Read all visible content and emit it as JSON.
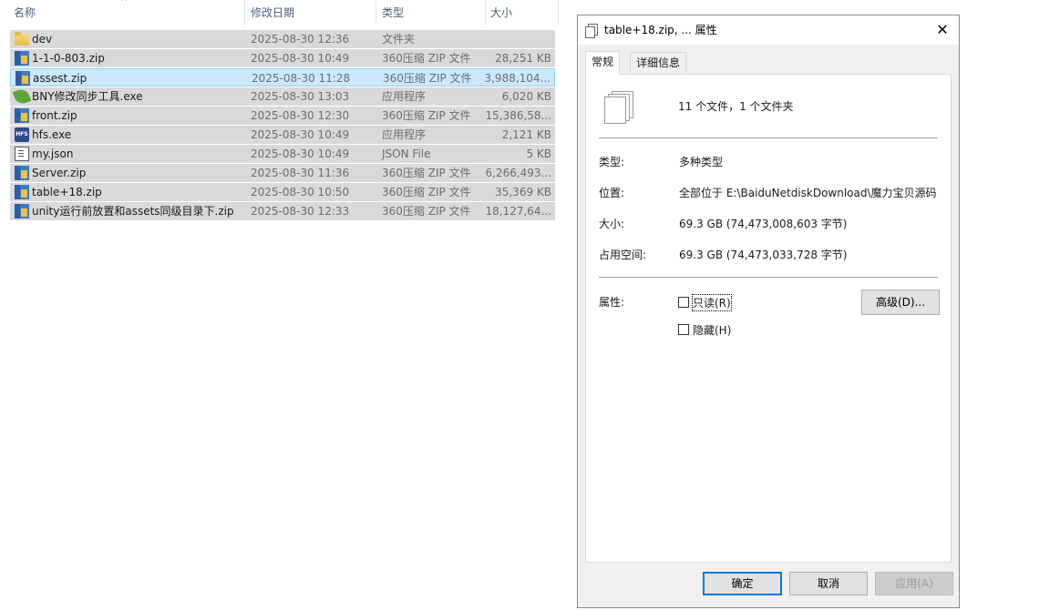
{
  "explorer": {
    "headers": {
      "name": "名称",
      "date": "修改日期",
      "type": "类型",
      "size": "大小"
    },
    "files": [
      {
        "name": "dev",
        "date": "2025-08-30 12:36",
        "type": "文件夹",
        "size": "",
        "icon": "folder-icon",
        "selected": false
      },
      {
        "name": "1-1-0-803.zip",
        "date": "2025-08-30 10:49",
        "type": "360压缩 ZIP 文件",
        "size": "28,251 KB",
        "icon": "zip-icon",
        "selected": false
      },
      {
        "name": "assest.zip",
        "date": "2025-08-30 11:28",
        "type": "360压缩 ZIP 文件",
        "size": "3,988,104...",
        "icon": "zip-icon",
        "selected": true
      },
      {
        "name": "BNY修改同步工具.exe",
        "date": "2025-08-30 13:03",
        "type": "应用程序",
        "size": "6,020 KB",
        "icon": "leaf-icon",
        "selected": false
      },
      {
        "name": "front.zip",
        "date": "2025-08-30 12:30",
        "type": "360压缩 ZIP 文件",
        "size": "15,386,58...",
        "icon": "zip-icon",
        "selected": false
      },
      {
        "name": "hfs.exe",
        "date": "2025-08-30 10:49",
        "type": "应用程序",
        "size": "2,121 KB",
        "icon": "hfs-icon",
        "selected": false
      },
      {
        "name": "my.json",
        "date": "2025-08-30 10:49",
        "type": "JSON File",
        "size": "5 KB",
        "icon": "json-file-icon",
        "selected": false
      },
      {
        "name": "Server.zip",
        "date": "2025-08-30 11:36",
        "type": "360压缩 ZIP 文件",
        "size": "6,266,493...",
        "icon": "zip-icon",
        "selected": false
      },
      {
        "name": "table+18.zip",
        "date": "2025-08-30 10:50",
        "type": "360压缩 ZIP 文件",
        "size": "35,369 KB",
        "icon": "zip-icon",
        "selected": false
      },
      {
        "name": "unity运行前放置和assets同级目录下.zip",
        "date": "2025-08-30 12:33",
        "type": "360压缩 ZIP 文件",
        "size": "18,127,64...",
        "icon": "zip-icon",
        "selected": false
      }
    ]
  },
  "dialog": {
    "title": "table+18.zip, ... 属性",
    "close": "✕",
    "tabs": {
      "general": "常规",
      "details": "详细信息"
    },
    "summary": "11 个文件，1 个文件夹",
    "type_label": "类型:",
    "type_value": "多种类型",
    "location_label": "位置:",
    "location_value": "全部位于 E:\\BaiduNetdiskDownload\\魔力宝贝源码",
    "size_label": "大小:",
    "size_value": "69.3 GB (74,473,008,603 字节)",
    "disk_label": "占用空间:",
    "disk_value": "69.3 GB (74,473,033,728 字节)",
    "attr_label": "属性:",
    "readonly_label": "只读(R)",
    "hidden_label": "隐藏(H)",
    "advanced_button": "高级(D)...",
    "ok_button": "确定",
    "cancel_button": "取消",
    "apply_button": "应用(A)"
  }
}
